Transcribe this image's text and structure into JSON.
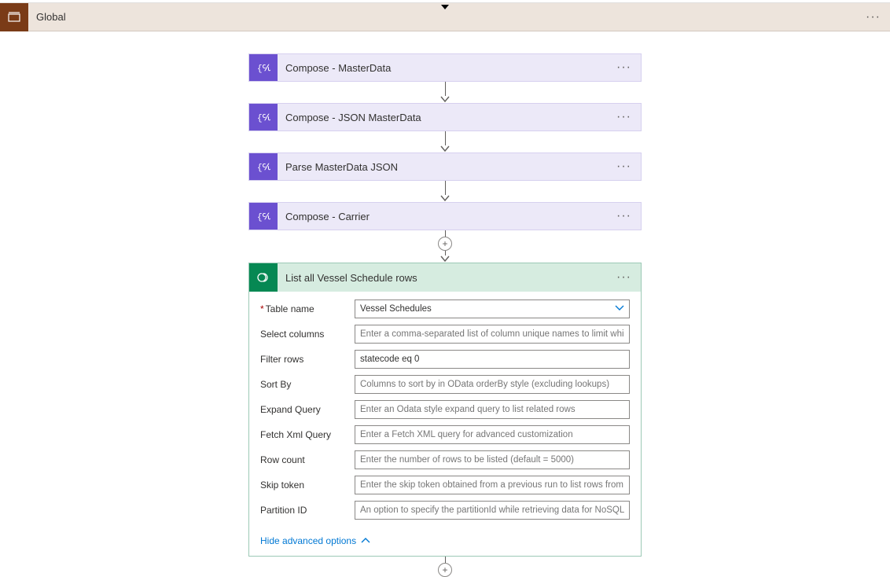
{
  "scope": {
    "label": "Global"
  },
  "actions": {
    "composeMaster": {
      "title": "Compose - MasterData"
    },
    "composeJson": {
      "title": "Compose - JSON MasterData"
    },
    "parseJson": {
      "title": "Parse MasterData JSON"
    },
    "composeCarrier": {
      "title": "Compose - Carrier"
    }
  },
  "dataverse": {
    "title": "List all Vessel Schedule rows",
    "fields": {
      "tableName": {
        "label": "Table name",
        "required": true,
        "value": "Vessel Schedules"
      },
      "selectCols": {
        "label": "Select columns",
        "placeholder": "Enter a comma-separated list of column unique names to limit which columns"
      },
      "filterRows": {
        "label": "Filter rows",
        "value": "statecode eq 0"
      },
      "sortBy": {
        "label": "Sort By",
        "placeholder": "Columns to sort by in OData orderBy style (excluding lookups)"
      },
      "expand": {
        "label": "Expand Query",
        "placeholder": "Enter an Odata style expand query to list related rows"
      },
      "fetchXml": {
        "label": "Fetch Xml Query",
        "placeholder": "Enter a Fetch XML query for advanced customization"
      },
      "rowCount": {
        "label": "Row count",
        "placeholder": "Enter the number of rows to be listed (default = 5000)"
      },
      "skipToken": {
        "label": "Skip token",
        "placeholder": "Enter the skip token obtained from a previous run to list rows from the next pa"
      },
      "partition": {
        "label": "Partition ID",
        "placeholder": "An option to specify the partitionId while retrieving data for NoSQL tables"
      }
    },
    "advancedToggle": "Hide advanced options"
  }
}
